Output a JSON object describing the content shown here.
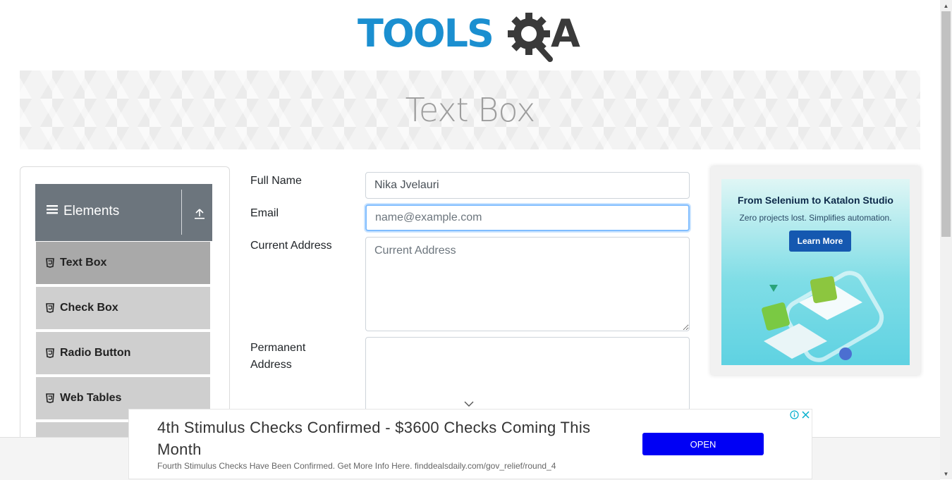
{
  "header": {
    "logo_text_a": "TOOLS",
    "logo_text_b": "A"
  },
  "banner": {
    "title": "Text Box"
  },
  "sidebar": {
    "group_title": "Elements",
    "items": [
      {
        "label": "Text Box",
        "active": true
      },
      {
        "label": "Check Box"
      },
      {
        "label": "Radio Button"
      },
      {
        "label": "Web Tables"
      }
    ]
  },
  "form": {
    "full_name_label": "Full Name",
    "full_name_value": "Nika Jvelauri",
    "email_label": "Email",
    "email_placeholder": "name@example.com",
    "current_address_label": "Current Address",
    "current_address_placeholder": "Current Address",
    "permanent_address_label_1": "Permanent",
    "permanent_address_label_2": "Address"
  },
  "side_ad": {
    "headline": "From Selenium to Katalon Studio",
    "subline": "Zero projects lost. Simplifies automation.",
    "button": "Learn More"
  },
  "bottom_ad": {
    "headline": "4th Stimulus Checks Confirmed - $3600 Checks Coming This Month",
    "description": "Fourth Stimulus Checks Have Been Confirmed. Get More Info Here. finddealsdaily.com/gov_relief/round_4",
    "button": "OPEN"
  },
  "colors": {
    "brand_blue": "#1b8fd0",
    "brand_dark": "#3a3a3a",
    "sidebar_header": "#6c757d",
    "focus_border": "#80bdff",
    "ad_button": "#0000f5"
  }
}
